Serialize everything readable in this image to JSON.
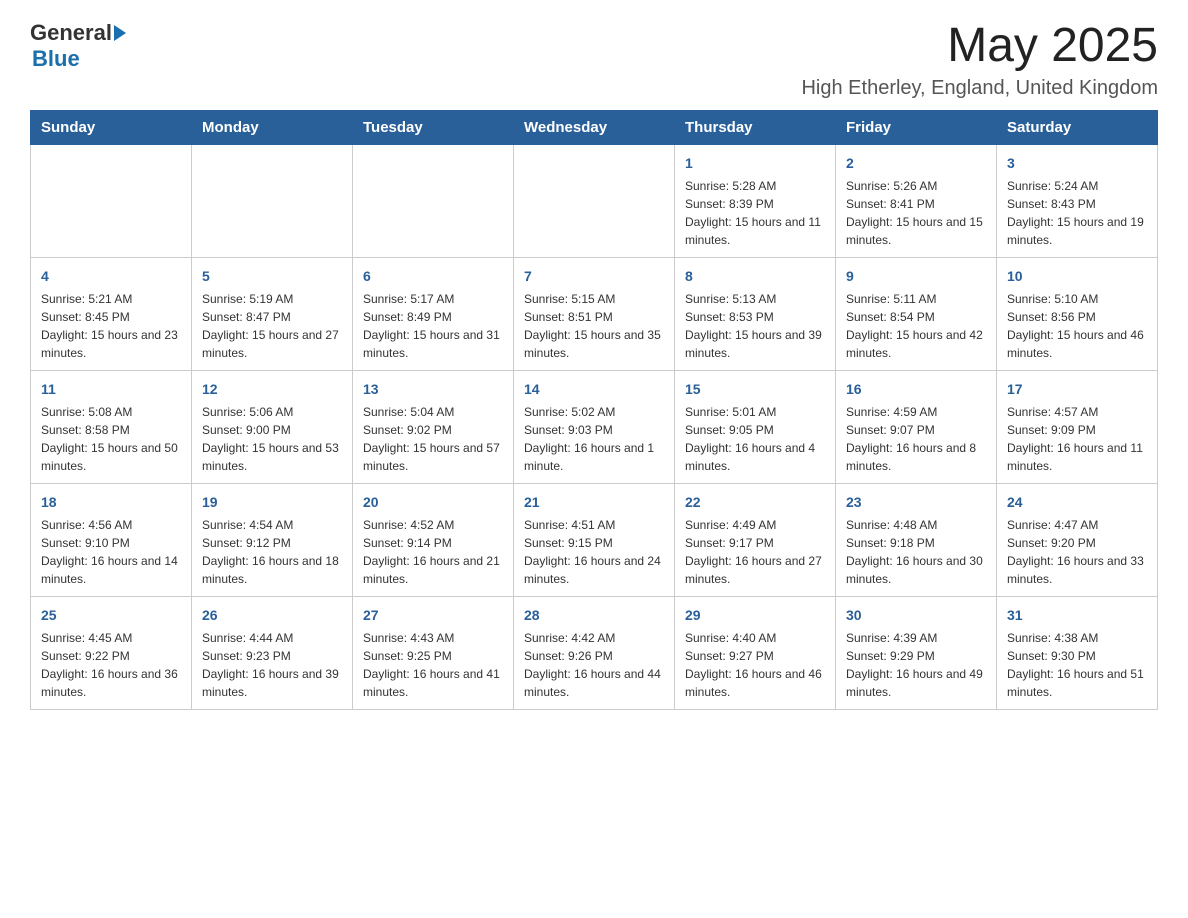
{
  "header": {
    "logo_general": "General",
    "logo_blue": "Blue",
    "month_year": "May 2025",
    "location": "High Etherley, England, United Kingdom"
  },
  "weekdays": [
    "Sunday",
    "Monday",
    "Tuesday",
    "Wednesday",
    "Thursday",
    "Friday",
    "Saturday"
  ],
  "weeks": [
    [
      {
        "day": "",
        "info": ""
      },
      {
        "day": "",
        "info": ""
      },
      {
        "day": "",
        "info": ""
      },
      {
        "day": "",
        "info": ""
      },
      {
        "day": "1",
        "info": "Sunrise: 5:28 AM\nSunset: 8:39 PM\nDaylight: 15 hours and 11 minutes."
      },
      {
        "day": "2",
        "info": "Sunrise: 5:26 AM\nSunset: 8:41 PM\nDaylight: 15 hours and 15 minutes."
      },
      {
        "day": "3",
        "info": "Sunrise: 5:24 AM\nSunset: 8:43 PM\nDaylight: 15 hours and 19 minutes."
      }
    ],
    [
      {
        "day": "4",
        "info": "Sunrise: 5:21 AM\nSunset: 8:45 PM\nDaylight: 15 hours and 23 minutes."
      },
      {
        "day": "5",
        "info": "Sunrise: 5:19 AM\nSunset: 8:47 PM\nDaylight: 15 hours and 27 minutes."
      },
      {
        "day": "6",
        "info": "Sunrise: 5:17 AM\nSunset: 8:49 PM\nDaylight: 15 hours and 31 minutes."
      },
      {
        "day": "7",
        "info": "Sunrise: 5:15 AM\nSunset: 8:51 PM\nDaylight: 15 hours and 35 minutes."
      },
      {
        "day": "8",
        "info": "Sunrise: 5:13 AM\nSunset: 8:53 PM\nDaylight: 15 hours and 39 minutes."
      },
      {
        "day": "9",
        "info": "Sunrise: 5:11 AM\nSunset: 8:54 PM\nDaylight: 15 hours and 42 minutes."
      },
      {
        "day": "10",
        "info": "Sunrise: 5:10 AM\nSunset: 8:56 PM\nDaylight: 15 hours and 46 minutes."
      }
    ],
    [
      {
        "day": "11",
        "info": "Sunrise: 5:08 AM\nSunset: 8:58 PM\nDaylight: 15 hours and 50 minutes."
      },
      {
        "day": "12",
        "info": "Sunrise: 5:06 AM\nSunset: 9:00 PM\nDaylight: 15 hours and 53 minutes."
      },
      {
        "day": "13",
        "info": "Sunrise: 5:04 AM\nSunset: 9:02 PM\nDaylight: 15 hours and 57 minutes."
      },
      {
        "day": "14",
        "info": "Sunrise: 5:02 AM\nSunset: 9:03 PM\nDaylight: 16 hours and 1 minute."
      },
      {
        "day": "15",
        "info": "Sunrise: 5:01 AM\nSunset: 9:05 PM\nDaylight: 16 hours and 4 minutes."
      },
      {
        "day": "16",
        "info": "Sunrise: 4:59 AM\nSunset: 9:07 PM\nDaylight: 16 hours and 8 minutes."
      },
      {
        "day": "17",
        "info": "Sunrise: 4:57 AM\nSunset: 9:09 PM\nDaylight: 16 hours and 11 minutes."
      }
    ],
    [
      {
        "day": "18",
        "info": "Sunrise: 4:56 AM\nSunset: 9:10 PM\nDaylight: 16 hours and 14 minutes."
      },
      {
        "day": "19",
        "info": "Sunrise: 4:54 AM\nSunset: 9:12 PM\nDaylight: 16 hours and 18 minutes."
      },
      {
        "day": "20",
        "info": "Sunrise: 4:52 AM\nSunset: 9:14 PM\nDaylight: 16 hours and 21 minutes."
      },
      {
        "day": "21",
        "info": "Sunrise: 4:51 AM\nSunset: 9:15 PM\nDaylight: 16 hours and 24 minutes."
      },
      {
        "day": "22",
        "info": "Sunrise: 4:49 AM\nSunset: 9:17 PM\nDaylight: 16 hours and 27 minutes."
      },
      {
        "day": "23",
        "info": "Sunrise: 4:48 AM\nSunset: 9:18 PM\nDaylight: 16 hours and 30 minutes."
      },
      {
        "day": "24",
        "info": "Sunrise: 4:47 AM\nSunset: 9:20 PM\nDaylight: 16 hours and 33 minutes."
      }
    ],
    [
      {
        "day": "25",
        "info": "Sunrise: 4:45 AM\nSunset: 9:22 PM\nDaylight: 16 hours and 36 minutes."
      },
      {
        "day": "26",
        "info": "Sunrise: 4:44 AM\nSunset: 9:23 PM\nDaylight: 16 hours and 39 minutes."
      },
      {
        "day": "27",
        "info": "Sunrise: 4:43 AM\nSunset: 9:25 PM\nDaylight: 16 hours and 41 minutes."
      },
      {
        "day": "28",
        "info": "Sunrise: 4:42 AM\nSunset: 9:26 PM\nDaylight: 16 hours and 44 minutes."
      },
      {
        "day": "29",
        "info": "Sunrise: 4:40 AM\nSunset: 9:27 PM\nDaylight: 16 hours and 46 minutes."
      },
      {
        "day": "30",
        "info": "Sunrise: 4:39 AM\nSunset: 9:29 PM\nDaylight: 16 hours and 49 minutes."
      },
      {
        "day": "31",
        "info": "Sunrise: 4:38 AM\nSunset: 9:30 PM\nDaylight: 16 hours and 51 minutes."
      }
    ]
  ]
}
